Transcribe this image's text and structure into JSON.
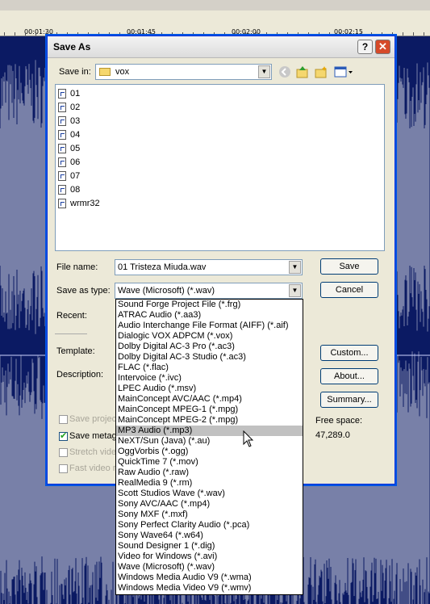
{
  "ruler": {
    "ticks": [
      "00:01:30",
      "00:01:45",
      "00:02:00",
      "00:02:15"
    ]
  },
  "dialog": {
    "title": "Save As",
    "save_in_label": "Save in:",
    "save_in_value": "vox",
    "files": [
      "01",
      "02",
      "03",
      "04",
      "05",
      "06",
      "07",
      "08",
      "wrmr32"
    ],
    "file_name_label": "File name:",
    "file_name_value": "01 Tristeza Miuda.wav",
    "save_as_type_label": "Save as type:",
    "save_as_type_value": "Wave (Microsoft) (*.wav)",
    "recent_label": "Recent:",
    "template_label": "Template:",
    "description_label": "Description:",
    "buttons": {
      "save": "Save",
      "cancel": "Cancel",
      "custom": "Custom...",
      "about": "About...",
      "summary": "Summary..."
    },
    "checks": {
      "save_project": "Save projec",
      "save_metadata": "Save metag",
      "stretch_video": "Stretch vide",
      "fast_video": "Fast video r"
    },
    "free_space_label": "Free space:",
    "free_space_value": "47,289.0"
  },
  "dropdown": {
    "selected_index": 12,
    "options": [
      "Sound Forge Project File (*.frg)",
      "ATRAC Audio (*.aa3)",
      "Audio Interchange File Format (AIFF) (*.aif)",
      "Dialogic VOX ADPCM (*.vox)",
      "Dolby Digital AC-3 Pro (*.ac3)",
      "Dolby Digital AC-3 Studio (*.ac3)",
      "FLAC (*.flac)",
      "Intervoice (*.ivc)",
      "LPEC Audio (*.msv)",
      "MainConcept AVC/AAC (*.mp4)",
      "MainConcept MPEG-1 (*.mpg)",
      "MainConcept MPEG-2 (*.mpg)",
      "MP3 Audio (*.mp3)",
      "NeXT/Sun (Java) (*.au)",
      "OggVorbis (*.ogg)",
      "QuickTime 7 (*.mov)",
      "Raw Audio (*.raw)",
      "RealMedia 9 (*.rm)",
      "Scott Studios Wave (*.wav)",
      "Sony AVC/AAC (*.mp4)",
      "Sony MXF (*.mxf)",
      "Sony Perfect Clarity Audio (*.pca)",
      "Sony Wave64 (*.w64)",
      "Sound Designer 1 (*.dig)",
      "Video for Windows (*.avi)",
      "Wave (Microsoft) (*.wav)",
      "Windows Media Audio V9 (*.wma)",
      "Windows Media Video V9 (*.wmv)"
    ]
  },
  "colors": {
    "waveform_bg": "#0b1a63",
    "waveform_fg": "#ffffff",
    "dialog_bg": "#ece9d8",
    "selection": "#c1c1c1"
  }
}
